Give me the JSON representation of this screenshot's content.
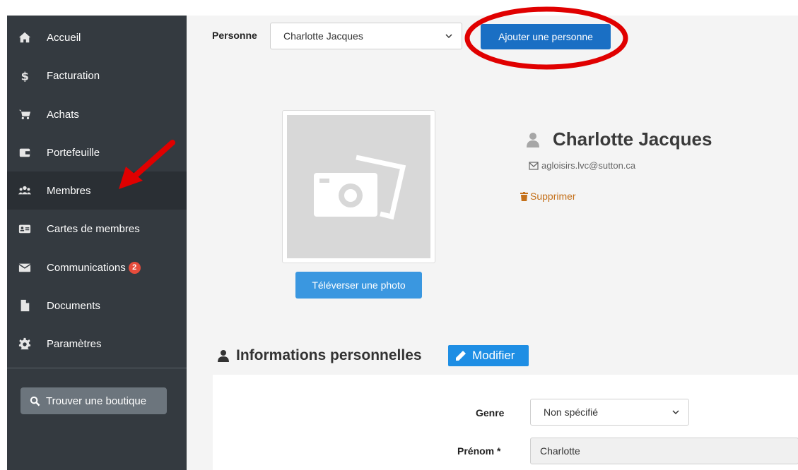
{
  "sidebar": {
    "items": [
      {
        "label": "Accueil",
        "icon": "home-icon"
      },
      {
        "label": "Facturation",
        "icon": "dollar-icon"
      },
      {
        "label": "Achats",
        "icon": "cart-icon"
      },
      {
        "label": "Portefeuille",
        "icon": "wallet-icon"
      },
      {
        "label": "Membres",
        "icon": "users-icon",
        "active": true
      },
      {
        "label": "Cartes de membres",
        "icon": "id-card-icon"
      },
      {
        "label": "Communications",
        "icon": "envelope-icon",
        "badge": "2"
      },
      {
        "label": "Documents",
        "icon": "file-icon"
      },
      {
        "label": "Paramètres",
        "icon": "gear-icon"
      }
    ],
    "find_shop_label": "Trouver une boutique"
  },
  "header": {
    "person_label": "Personne",
    "person_selected": "Charlotte Jacques",
    "add_person_label": "Ajouter une personne"
  },
  "profile": {
    "name": "Charlotte Jacques",
    "email": "agloisirs.lvc@sutton.ca",
    "delete_label": "Supprimer",
    "upload_label": "Téléverser une photo"
  },
  "personal_info": {
    "title": "Informations personnelles",
    "edit_label": "Modifier",
    "genre_label": "Genre",
    "genre_value": "Non spécifié",
    "prenom_label": "Prénom *",
    "prenom_value": "Charlotte"
  },
  "colors": {
    "sidebar_bg": "#343a40",
    "primary_button": "#1a6fc4",
    "annotation_red": "#e00000",
    "delete_link": "#c4701a"
  }
}
